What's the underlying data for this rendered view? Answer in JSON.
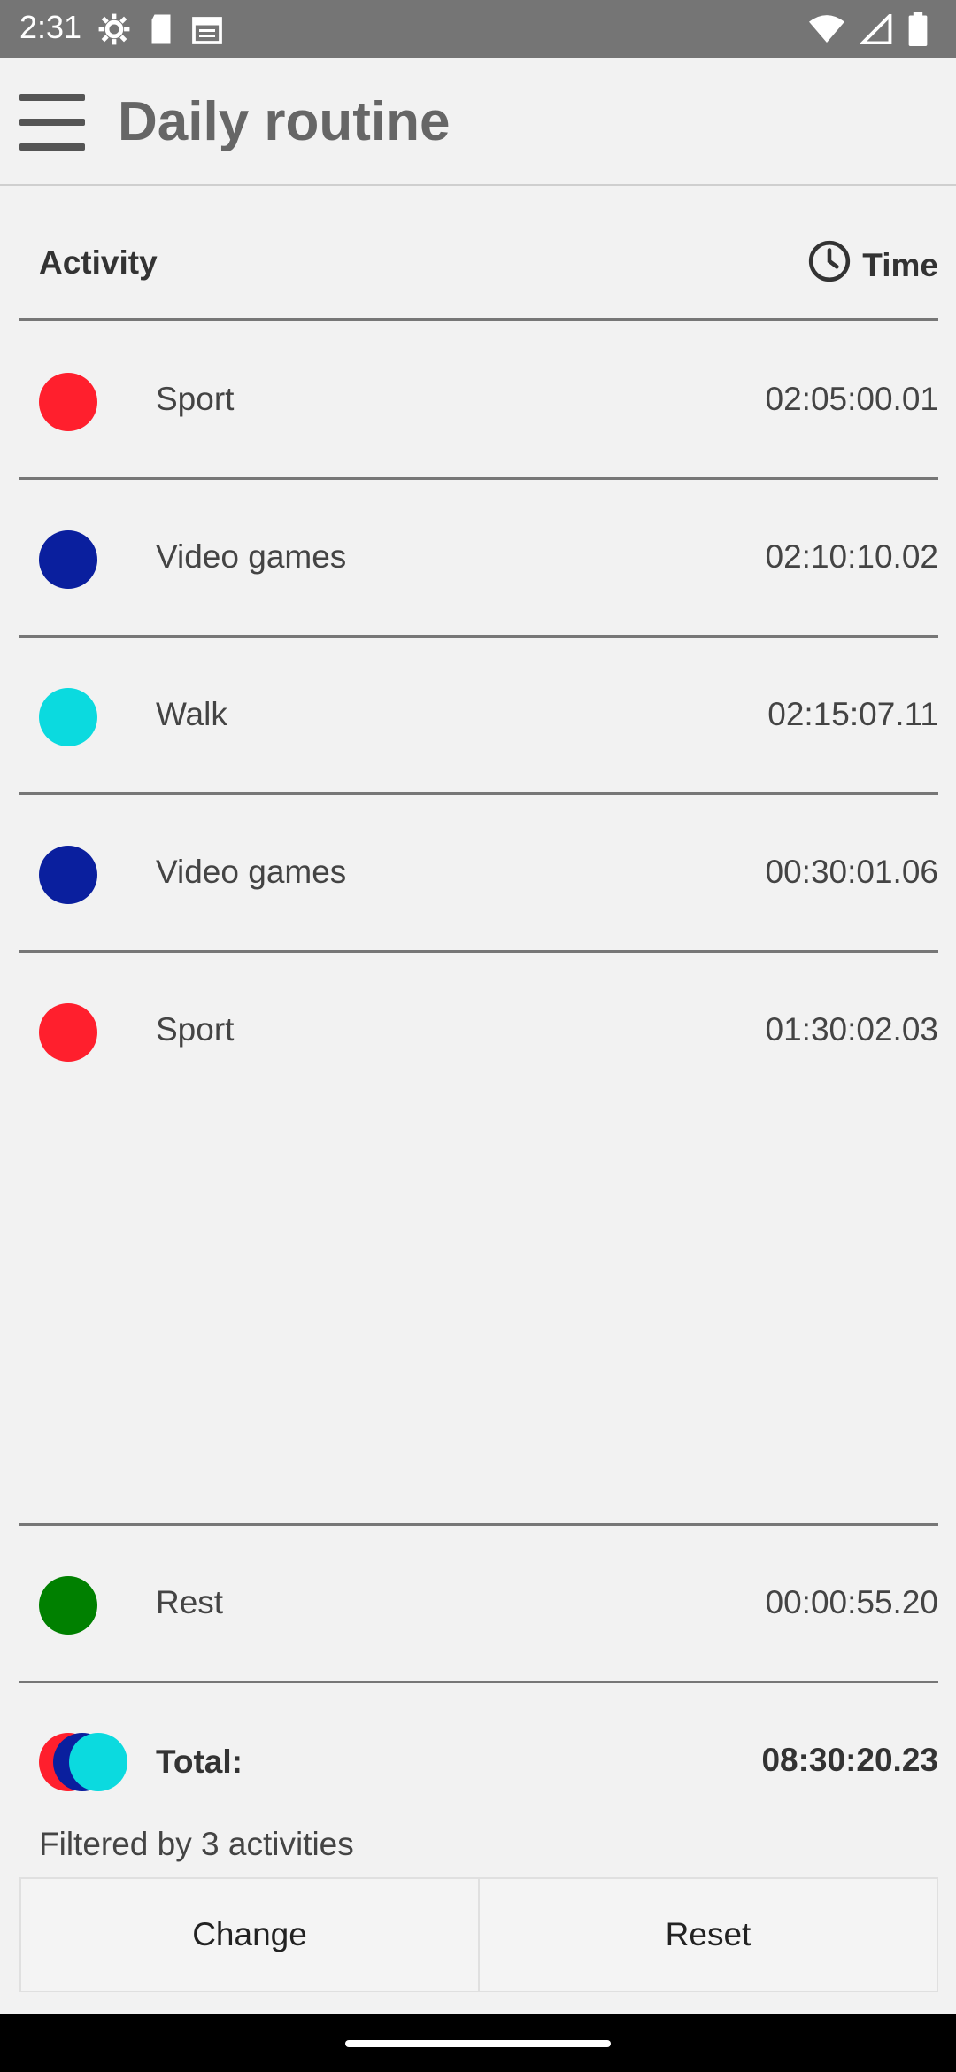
{
  "status": {
    "time": "2:31",
    "left_icons": [
      "settings-icon",
      "sdcard-icon",
      "calendar-icon"
    ],
    "right_icons": [
      "wifi-icon",
      "cell-signal-icon",
      "battery-icon"
    ]
  },
  "appbar": {
    "title": "Daily routine"
  },
  "header": {
    "activity_label": "Activity",
    "time_label": "Time"
  },
  "rows": [
    {
      "name": "Sport",
      "time": "02:05:00.01",
      "color": "#ff1f2d"
    },
    {
      "name": "Video games",
      "time": "02:10:10.02",
      "color": "#0a1f9e"
    },
    {
      "name": "Walk",
      "time": "02:15:07.11",
      "color": "#0bdadf"
    },
    {
      "name": "Video games",
      "time": "00:30:01.06",
      "color": "#0a1f9e"
    },
    {
      "name": "Sport",
      "time": "01:30:02.03",
      "color": "#ff1f2d"
    }
  ],
  "rest": {
    "name": "Rest",
    "time": "00:00:55.20",
    "color": "#008000"
  },
  "total": {
    "label": "Total:",
    "value": "08:30:20.23",
    "colors": [
      "#ff1f2d",
      "#0a1f9e",
      "#0bdadf"
    ]
  },
  "filtered_text": "Filtered by 3 activities",
  "buttons": {
    "change": "Change",
    "reset": "Reset"
  }
}
